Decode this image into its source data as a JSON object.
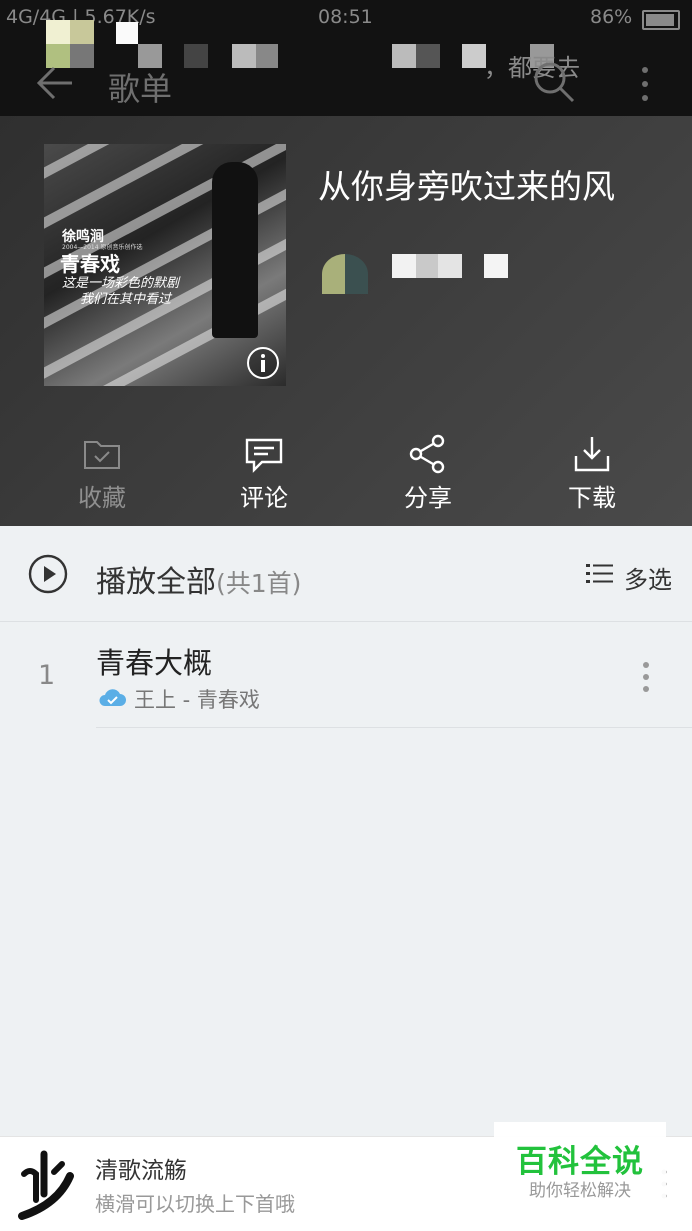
{
  "status_bar": {
    "carrier": "4G/4G | 5.67K/s",
    "time": "08:51",
    "battery": "86%"
  },
  "toolbar": {
    "back_icon": "arrow-left-icon",
    "title": "歌单",
    "notice": "，都要去",
    "search_icon": "search-icon",
    "more_icon": "more-vertical-icon"
  },
  "playlist": {
    "title": "从你身旁吹过来的风",
    "cover_text": {
      "artist": "徐鸣涧",
      "subtitle": "2004—2014 原创音乐创作选",
      "album": "青春戏",
      "line1": "这是一场彩色的默剧",
      "line2": "我们在其中看过"
    }
  },
  "actions": [
    {
      "label": "收藏",
      "icon": "folder-check-icon",
      "dim": true
    },
    {
      "label": "评论",
      "icon": "comment-icon",
      "dim": false
    },
    {
      "label": "分享",
      "icon": "share-icon",
      "dim": false
    },
    {
      "label": "下载",
      "icon": "download-icon",
      "dim": false
    }
  ],
  "play_all": {
    "label": "播放全部",
    "count": "(共1首)",
    "multi_select": "多选"
  },
  "tracks": [
    {
      "index": "1",
      "title": "青春大概",
      "subtitle": "王上 - 青春戏",
      "cloud_icon": "cloud-check-icon"
    }
  ],
  "mini_player": {
    "title": "清歌流觞",
    "hint": "横滑可以切换上下首哦"
  },
  "watermark": {
    "title": "百科全说",
    "subtitle": "助你轻松解决"
  },
  "colors": {
    "accent_green": "#22c23c",
    "header_dark": "#121212",
    "cloud_blue": "#5aaee6"
  }
}
